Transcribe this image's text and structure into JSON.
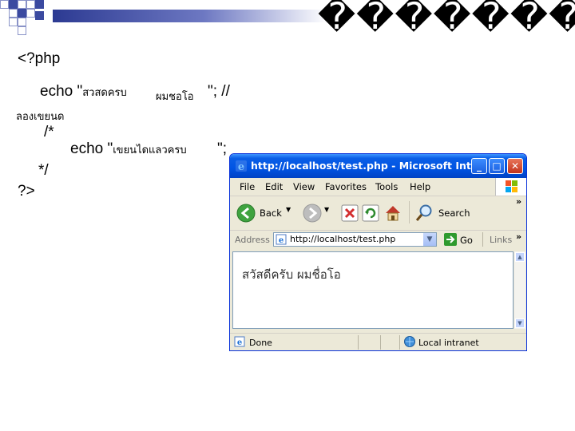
{
  "slide": {
    "title": "��������"
  },
  "code": {
    "line1": "<?php",
    "line2_prefix": "echo \"",
    "line2_thai_a": "สวสดครบ",
    "line2_thai_b": "ผมชอโอ",
    "line2_suffix": "\"; //",
    "line3_thai": "ลองเขยนด",
    "line4": "/*",
    "line5_prefix": "echo \"",
    "line5_thai": "เขยนไดแลวครบ",
    "line5_suffix": "\";",
    "line6": "*/",
    "line7": "?>"
  },
  "browser": {
    "title": "http://localhost/test.php - Microsoft Int...",
    "menu": [
      "File",
      "Edit",
      "View",
      "Favorites",
      "Tools",
      "Help"
    ],
    "toolbar": {
      "back_label": "Back",
      "search_label": "Search",
      "more": "»"
    },
    "address": {
      "label": "Address",
      "value": "http://localhost/test.php",
      "go_label": "Go",
      "links_label": "Links",
      "more": "»"
    },
    "content_text": "สวัสดีครับ ผมชื่อโอ",
    "status": {
      "left": "Done",
      "zone": "Local intranet"
    },
    "colors": {
      "titlebar": "#0054e3",
      "chrome": "#ece9d8"
    }
  }
}
